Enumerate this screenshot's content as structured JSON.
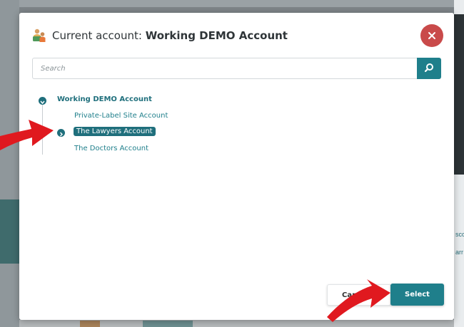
{
  "modal": {
    "title_prefix": "Current account: ",
    "title_account": "Working DEMO Account"
  },
  "search": {
    "placeholder": "Search",
    "value": ""
  },
  "tree": {
    "root": {
      "label": "Working DEMO Account",
      "expanded": true
    },
    "children": [
      {
        "label": "Private-Label Site Account",
        "selected": false,
        "has_children": false
      },
      {
        "label": "The Lawyers Account",
        "selected": true,
        "has_children": true
      },
      {
        "label": "The Doctors Account",
        "selected": false,
        "has_children": false
      }
    ]
  },
  "footer": {
    "cancel_label": "Cancel",
    "select_label": "Select"
  },
  "background": {
    "peek_text_1": "sco",
    "peek_text_2": "arr"
  },
  "colors": {
    "accent": "#1f7f8b",
    "accent_dark": "#1f6f7c",
    "close": "#c94a4a",
    "annotation_arrow": "#e0191f"
  },
  "icons": {
    "header": "account-users-icon",
    "close": "close-icon",
    "search": "search-icon",
    "toggle_expanded": "chevron-down-icon",
    "toggle_collapsed": "chevron-right-icon"
  }
}
